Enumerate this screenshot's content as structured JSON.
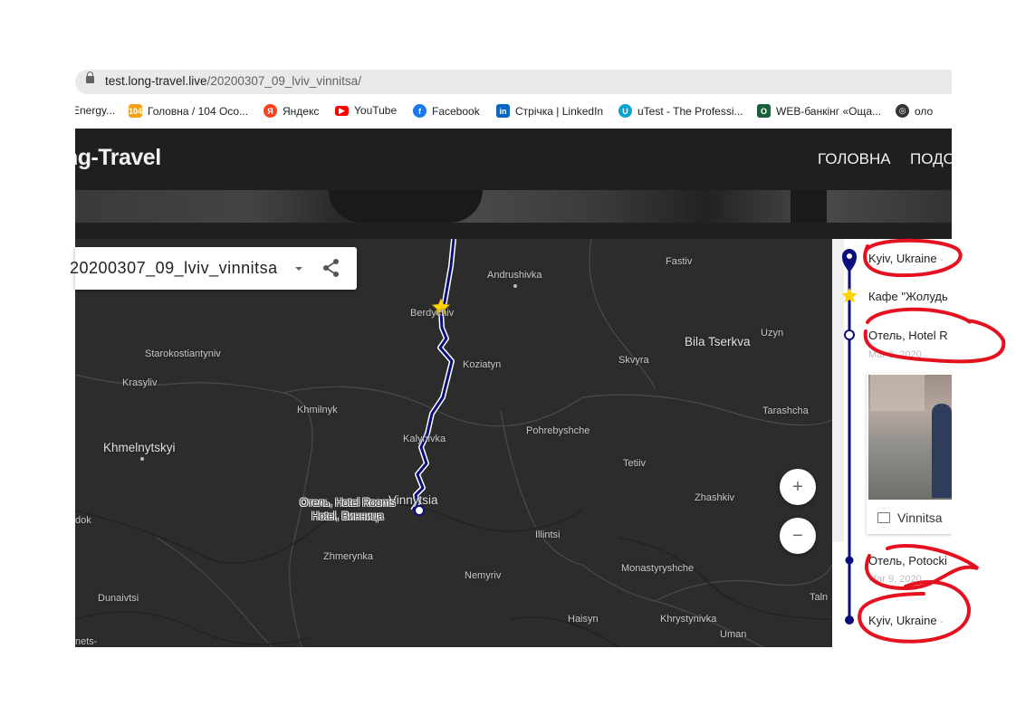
{
  "browser": {
    "url_host": "test.long-travel.live",
    "url_path": "/20200307_09_lviv_vinnitsa/",
    "bookmarks": [
      {
        "label": "Energy...",
        "icon": "energy-bookmark-icon",
        "color": "#4a7bd0"
      },
      {
        "label": "Головна / 104 Осо...",
        "icon": "104-icon",
        "color": "#f7a11a"
      },
      {
        "label": "Яндекс",
        "icon": "yandex-icon",
        "color": "#fc3f1d"
      },
      {
        "label": "YouTube",
        "icon": "youtube-icon",
        "color": "#ff0000"
      },
      {
        "label": "Facebook",
        "icon": "facebook-icon",
        "color": "#1877f2"
      },
      {
        "label": "Стрічка | LinkedIn",
        "icon": "linkedin-icon",
        "color": "#0a66c2"
      },
      {
        "label": "uTest - The Professi...",
        "icon": "utest-icon",
        "color": "#00a3d3"
      },
      {
        "label": "WEB-банкінг «Оща...",
        "icon": "oschadbank-icon",
        "color": "#1b5e3a"
      },
      {
        "label": "оло",
        "icon": "globe-icon",
        "color": "#333333"
      }
    ]
  },
  "site": {
    "logo": "ng-Travel",
    "nav": {
      "home": "ГОЛОВНА",
      "next": "ПОДО"
    }
  },
  "map": {
    "trip_name": "20200307_09_lviv_vinnitsa",
    "zoom_in": "+",
    "zoom_out": "−",
    "marker_label_line1": "Отель, Hotel Rooms",
    "marker_label_line2": "Hotel, Винница",
    "route_color": "#0b0f7a",
    "cities": {
      "andrushivka": "Andrushivka",
      "fastiv": "Fastiv",
      "berdychiv": "Berdychiv",
      "starokostiantyniv": "Starokostiantyniv",
      "bila_tserkva": "Bila Tserkva",
      "uzyn": "Uzyn",
      "koziatyn": "Koziatyn",
      "skvyra": "Skvyra",
      "krasyliv": "Krasyliv",
      "khmilnyk": "Khmilnyk",
      "tarashcha": "Tarashcha",
      "pohrebyshche": "Pohrebyshche",
      "kalynivka": "Kalynivka",
      "khmelnytskyi": "Khmelnytskyi",
      "tetiiv": "Tetiiv",
      "vinnytsia": "Vinnytsia",
      "zhashkiv": "Zhashkiv",
      "dok": "dok",
      "illintsi": "Illintsi",
      "zhmerynka": "Zhmerynka",
      "monastyryshche": "Monastyryshche",
      "nemyriv": "Nemyriv",
      "dunaivtsi": "Dunaivtsi",
      "talne": "Taln",
      "haisyn": "Haisyn",
      "khrystynivka": "Khrystynivka",
      "uman": "Uman",
      "nets": "nets-"
    }
  },
  "timeline": {
    "color": "#0b0f7a",
    "annotation_color": "#e4121f",
    "stops": [
      {
        "label": "Kyiv, Ukraine",
        "suffix": "-"
      },
      {
        "label": "Кафе \"Жолудь",
        "suffix": ""
      },
      {
        "label": "Отель, Hotel R",
        "suffix": ""
      },
      {
        "label": "Отель, Potocki",
        "suffix": ""
      },
      {
        "label": "Kyiv, Ukraine",
        "suffix": "-"
      }
    ],
    "dates": {
      "hotel": "Mar 8, 2020",
      "potocki": "Mar 9, 2020"
    },
    "photo_caption": "Vinnitsa"
  }
}
